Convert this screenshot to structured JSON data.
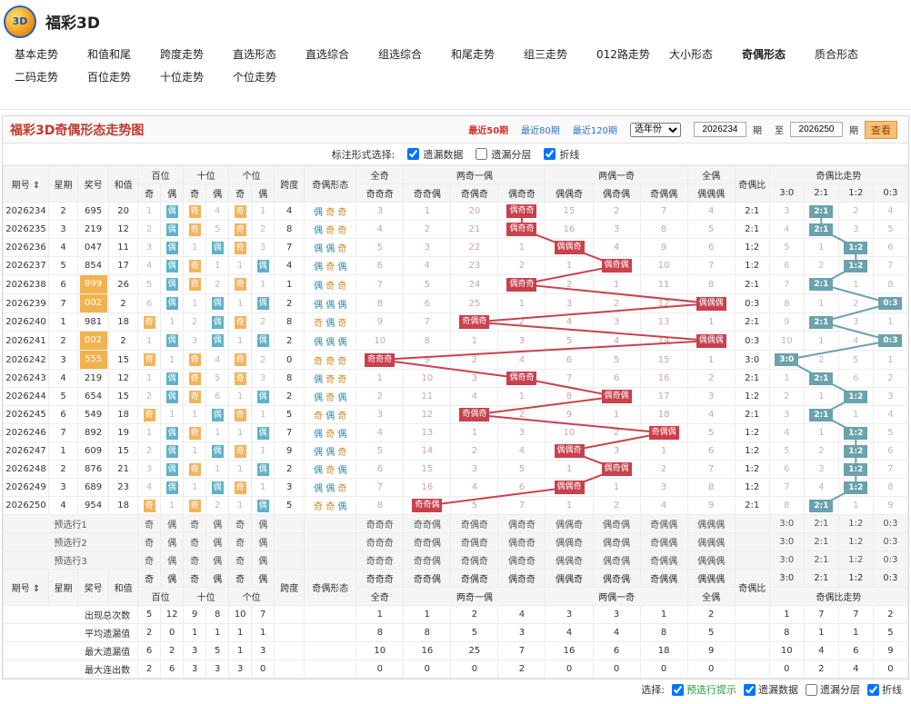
{
  "app": {
    "title": "福彩3D"
  },
  "nav": {
    "row1": [
      "基本走势",
      "和值和尾",
      "跨度走势",
      "直选形态",
      "直选综合",
      "组选综合",
      "和尾走势",
      "组三走势",
      "012路走势",
      "大小形态",
      "奇偶形态",
      "质合形态"
    ],
    "row2": [
      "二码走势",
      "百位走势",
      "十位走势",
      "个位走势"
    ],
    "active": "奇偶形态"
  },
  "panel": {
    "title": "福彩3D奇偶形态走势图",
    "links": [
      "最近50期",
      "最近80期",
      "最近120期"
    ],
    "year_select": "选年份",
    "from": "2026234",
    "to": "2026250",
    "qi": "期",
    "zhi": "至",
    "query": "查看"
  },
  "markbar": {
    "label": "标注形式选择:",
    "opt1": "遗漏数据",
    "opt2": "遗漏分层",
    "opt3": "折线"
  },
  "headers": {
    "period": "期号",
    "week": "星期",
    "prize": "奖号",
    "sum": "和值",
    "bai": "百位",
    "shi": "十位",
    "ge": "个位",
    "odd": "奇",
    "even": "偶",
    "span": "跨度",
    "shape": "奇偶形态",
    "quanji": "全奇",
    "liangqi": "两奇一偶",
    "liangou": "两偶一奇",
    "quanou": "全偶",
    "ratio": "奇偶比",
    "ratio_trend": "奇偶比走势",
    "combos": [
      "奇奇奇",
      "奇奇偶",
      "奇偶奇",
      "偶奇奇",
      "偶偶奇",
      "偶奇偶",
      "奇偶偶",
      "偶偶偶"
    ],
    "ratios": [
      "3:0",
      "2:1",
      "1:2",
      "0:3"
    ]
  },
  "rows": [
    {
      "p": "2026234",
      "w": "2",
      "n": "695",
      "s": "20",
      "b": [
        "1",
        "偶"
      ],
      "sh": [
        "奇",
        "4"
      ],
      "g": [
        "奇",
        "1"
      ],
      "span": "4",
      "shape": [
        "偶",
        "奇",
        "奇"
      ],
      "m": [
        "3",
        "1",
        "20",
        "偶奇奇",
        "15",
        "2",
        "7",
        "4"
      ],
      "ratio": "2:1",
      "rt": [
        "3",
        "2:1",
        "2",
        "4"
      ],
      "hl": false
    },
    {
      "p": "2026235",
      "w": "3",
      "n": "219",
      "s": "12",
      "b": [
        "2",
        "偶"
      ],
      "sh": [
        "奇",
        "5"
      ],
      "g": [
        "奇",
        "2"
      ],
      "span": "8",
      "shape": [
        "偶",
        "奇",
        "奇"
      ],
      "m": [
        "4",
        "2",
        "21",
        "偶奇奇",
        "16",
        "3",
        "8",
        "5"
      ],
      "ratio": "2:1",
      "rt": [
        "4",
        "2:1",
        "3",
        "5"
      ],
      "hl": false
    },
    {
      "p": "2026236",
      "w": "4",
      "n": "047",
      "s": "11",
      "b": [
        "3",
        "偶"
      ],
      "sh": [
        "1",
        "偶"
      ],
      "g": [
        "奇",
        "3"
      ],
      "span": "7",
      "shape": [
        "偶",
        "偶",
        "奇"
      ],
      "m": [
        "5",
        "3",
        "22",
        "1",
        "偶偶奇",
        "4",
        "9",
        "6"
      ],
      "ratio": "1:2",
      "rt": [
        "5",
        "1",
        "1:2",
        "6"
      ],
      "hl": false
    },
    {
      "p": "2026237",
      "w": "5",
      "n": "854",
      "s": "17",
      "b": [
        "4",
        "偶"
      ],
      "sh": [
        "奇",
        "1"
      ],
      "g": [
        "1",
        "偶"
      ],
      "span": "4",
      "shape": [
        "偶",
        "奇",
        "偶"
      ],
      "m": [
        "6",
        "4",
        "23",
        "2",
        "1",
        "偶奇偶",
        "10",
        "7"
      ],
      "ratio": "1:2",
      "rt": [
        "6",
        "2",
        "1:2",
        "7"
      ],
      "hl": false
    },
    {
      "p": "2026238",
      "w": "6",
      "n": "899",
      "s": "26",
      "b": [
        "5",
        "偶"
      ],
      "sh": [
        "奇",
        "2"
      ],
      "g": [
        "奇",
        "1"
      ],
      "span": "1",
      "shape": [
        "偶",
        "奇",
        "奇"
      ],
      "m": [
        "7",
        "5",
        "24",
        "偶奇奇",
        "2",
        "1",
        "11",
        "8"
      ],
      "ratio": "2:1",
      "rt": [
        "7",
        "2:1",
        "1",
        "8"
      ],
      "hl": true
    },
    {
      "p": "2026239",
      "w": "7",
      "n": "002",
      "s": "2",
      "b": [
        "6",
        "偶"
      ],
      "sh": [
        "1",
        "偶"
      ],
      "g": [
        "1",
        "偶"
      ],
      "span": "2",
      "shape": [
        "偶",
        "偶",
        "偶"
      ],
      "m": [
        "8",
        "6",
        "25",
        "1",
        "3",
        "2",
        "12",
        "偶偶偶"
      ],
      "ratio": "0:3",
      "rt": [
        "8",
        "1",
        "2",
        "0:3"
      ],
      "hl": true
    },
    {
      "p": "2026240",
      "w": "1",
      "n": "981",
      "s": "18",
      "b": [
        "奇",
        "1"
      ],
      "sh": [
        "2",
        "偶"
      ],
      "g": [
        "奇",
        "2"
      ],
      "span": "8",
      "shape": [
        "奇",
        "偶",
        "奇"
      ],
      "m": [
        "9",
        "7",
        "奇偶奇",
        "2",
        "4",
        "3",
        "13",
        "1"
      ],
      "ratio": "2:1",
      "rt": [
        "9",
        "2:1",
        "3",
        "1"
      ],
      "hl": false
    },
    {
      "p": "2026241",
      "w": "2",
      "n": "002",
      "s": "2",
      "b": [
        "1",
        "偶"
      ],
      "sh": [
        "3",
        "偶"
      ],
      "g": [
        "1",
        "偶"
      ],
      "span": "2",
      "shape": [
        "偶",
        "偶",
        "偶"
      ],
      "m": [
        "10",
        "8",
        "1",
        "3",
        "5",
        "4",
        "14",
        "偶偶偶"
      ],
      "ratio": "0:3",
      "rt": [
        "10",
        "1",
        "4",
        "0:3"
      ],
      "hl": true
    },
    {
      "p": "2026242",
      "w": "3",
      "n": "555",
      "s": "15",
      "b": [
        "奇",
        "1"
      ],
      "sh": [
        "奇",
        "4"
      ],
      "g": [
        "奇",
        "2"
      ],
      "span": "0",
      "shape": [
        "奇",
        "奇",
        "奇"
      ],
      "m": [
        "奇奇奇",
        "9",
        "2",
        "4",
        "6",
        "5",
        "15",
        "1"
      ],
      "ratio": "3:0",
      "rt": [
        "3:0",
        "2",
        "5",
        "1"
      ],
      "hl": true
    },
    {
      "p": "2026243",
      "w": "4",
      "n": "219",
      "s": "12",
      "b": [
        "1",
        "偶"
      ],
      "sh": [
        "奇",
        "5"
      ],
      "g": [
        "奇",
        "3"
      ],
      "span": "8",
      "shape": [
        "偶",
        "奇",
        "奇"
      ],
      "m": [
        "1",
        "10",
        "3",
        "偶奇奇",
        "7",
        "6",
        "16",
        "2"
      ],
      "ratio": "2:1",
      "rt": [
        "1",
        "2:1",
        "6",
        "2"
      ],
      "hl": false
    },
    {
      "p": "2026244",
      "w": "5",
      "n": "654",
      "s": "15",
      "b": [
        "2",
        "偶"
      ],
      "sh": [
        "奇",
        "6"
      ],
      "g": [
        "1",
        "偶"
      ],
      "span": "2",
      "shape": [
        "偶",
        "奇",
        "偶"
      ],
      "m": [
        "2",
        "11",
        "4",
        "1",
        "8",
        "偶奇偶",
        "17",
        "3"
      ],
      "ratio": "1:2",
      "rt": [
        "2",
        "1",
        "1:2",
        "3"
      ],
      "hl": false
    },
    {
      "p": "2026245",
      "w": "6",
      "n": "549",
      "s": "18",
      "b": [
        "奇",
        "1"
      ],
      "sh": [
        "1",
        "偶"
      ],
      "g": [
        "奇",
        "1"
      ],
      "span": "5",
      "shape": [
        "奇",
        "偶",
        "奇"
      ],
      "m": [
        "3",
        "12",
        "奇偶奇",
        "2",
        "9",
        "1",
        "18",
        "4"
      ],
      "ratio": "2:1",
      "rt": [
        "3",
        "2:1",
        "1",
        "4"
      ],
      "hl": false
    },
    {
      "p": "2026246",
      "w": "7",
      "n": "892",
      "s": "19",
      "b": [
        "1",
        "偶"
      ],
      "sh": [
        "奇",
        "1"
      ],
      "g": [
        "1",
        "偶"
      ],
      "span": "7",
      "shape": [
        "偶",
        "奇",
        "偶"
      ],
      "m": [
        "4",
        "13",
        "1",
        "3",
        "10",
        "2",
        "奇偶偶",
        "5"
      ],
      "ratio": "1:2",
      "rt": [
        "4",
        "1",
        "1:2",
        "5"
      ],
      "hl": false
    },
    {
      "p": "2026247",
      "w": "1",
      "n": "609",
      "s": "15",
      "b": [
        "2",
        "偶"
      ],
      "sh": [
        "1",
        "偶"
      ],
      "g": [
        "奇",
        "1"
      ],
      "span": "9",
      "shape": [
        "偶",
        "偶",
        "奇"
      ],
      "m": [
        "5",
        "14",
        "2",
        "4",
        "偶偶奇",
        "3",
        "1",
        "6"
      ],
      "ratio": "1:2",
      "rt": [
        "5",
        "2",
        "1:2",
        "6"
      ],
      "hl": false
    },
    {
      "p": "2026248",
      "w": "2",
      "n": "876",
      "s": "21",
      "b": [
        "3",
        "偶"
      ],
      "sh": [
        "奇",
        "1"
      ],
      "g": [
        "1",
        "偶"
      ],
      "span": "2",
      "shape": [
        "偶",
        "奇",
        "偶"
      ],
      "m": [
        "6",
        "15",
        "3",
        "5",
        "1",
        "偶奇偶",
        "2",
        "7"
      ],
      "ratio": "1:2",
      "rt": [
        "6",
        "3",
        "1:2",
        "7"
      ],
      "hl": false
    },
    {
      "p": "2026249",
      "w": "3",
      "n": "689",
      "s": "23",
      "b": [
        "4",
        "偶"
      ],
      "sh": [
        "1",
        "偶"
      ],
      "g": [
        "奇",
        "1"
      ],
      "span": "3",
      "shape": [
        "偶",
        "偶",
        "奇"
      ],
      "m": [
        "7",
        "16",
        "4",
        "6",
        "偶偶奇",
        "1",
        "3",
        "8"
      ],
      "ratio": "1:2",
      "rt": [
        "7",
        "4",
        "1:2",
        "8"
      ],
      "hl": false
    },
    {
      "p": "2026250",
      "w": "4",
      "n": "954",
      "s": "18",
      "b": [
        "奇",
        "1"
      ],
      "sh": [
        "奇",
        "2"
      ],
      "g": [
        "1",
        "偶"
      ],
      "span": "5",
      "shape": [
        "奇",
        "奇",
        "偶"
      ],
      "m": [
        "8",
        "奇奇偶",
        "5",
        "7",
        "1",
        "2",
        "4",
        "9"
      ],
      "ratio": "2:1",
      "rt": [
        "8",
        "2:1",
        "1",
        "9"
      ],
      "hl": false
    }
  ],
  "presel": [
    "预选行1",
    "预选行2",
    "预选行3"
  ],
  "stats": [
    {
      "label": "出现总次数",
      "pos": [
        "5",
        "12",
        "9",
        "8",
        "10",
        "7"
      ],
      "m": [
        "1",
        "1",
        "2",
        "4",
        "3",
        "3",
        "1",
        "2"
      ],
      "rt": [
        "1",
        "7",
        "7",
        "2"
      ]
    },
    {
      "label": "平均遗漏值",
      "pos": [
        "2",
        "0",
        "1",
        "1",
        "1",
        "1"
      ],
      "m": [
        "8",
        "8",
        "5",
        "3",
        "4",
        "4",
        "8",
        "5"
      ],
      "rt": [
        "8",
        "1",
        "1",
        "5"
      ]
    },
    {
      "label": "最大遗漏值",
      "pos": [
        "6",
        "2",
        "3",
        "5",
        "1",
        "3"
      ],
      "m": [
        "10",
        "16",
        "25",
        "7",
        "16",
        "6",
        "18",
        "9"
      ],
      "rt": [
        "10",
        "4",
        "6",
        "9"
      ]
    },
    {
      "label": "最大连出数",
      "pos": [
        "2",
        "6",
        "3",
        "3",
        "3",
        "0"
      ],
      "m": [
        "0",
        "0",
        "0",
        "2",
        "0",
        "0",
        "0",
        "0"
      ],
      "rt": [
        "0",
        "2",
        "4",
        "0"
      ]
    }
  ],
  "footer": {
    "label": "选择:",
    "opt1": "预选行提示",
    "opt2": "遗漏数据",
    "opt3": "遗漏分层",
    "opt4": "折线"
  },
  "colors": {
    "odd": "#f4b45d",
    "even": "#5fb2c7",
    "tag": "#c9414d",
    "ratio_tag": "#6aa2ad",
    "title": "#c0392b"
  }
}
